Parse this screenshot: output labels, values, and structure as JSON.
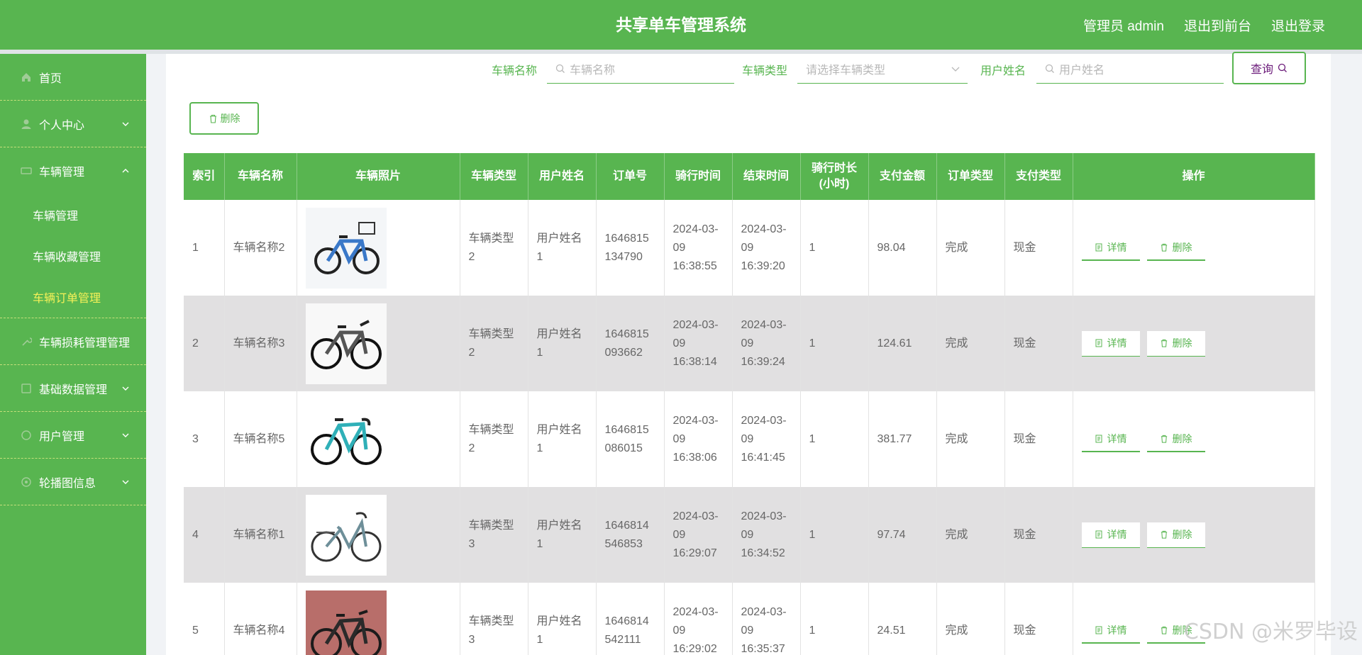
{
  "header": {
    "title": "共享单车管理系统",
    "admin_label": "管理员 admin",
    "to_front_label": "退出到前台",
    "logout_label": "退出登录"
  },
  "sidebar": {
    "items": [
      {
        "label": "首页"
      },
      {
        "label": "个人中心"
      },
      {
        "label": "车辆管理"
      },
      {
        "label": "车辆损耗管理管理"
      },
      {
        "label": "基础数据管理"
      },
      {
        "label": "用户管理"
      },
      {
        "label": "轮播图信息"
      }
    ],
    "submenu": [
      {
        "label": "车辆管理"
      },
      {
        "label": "车辆收藏管理"
      },
      {
        "label": "车辆订单管理"
      }
    ]
  },
  "search": {
    "vehicle_name_label": "车辆名称",
    "vehicle_name_placeholder": "车辆名称",
    "vehicle_type_label": "车辆类型",
    "vehicle_type_placeholder": "请选择车辆类型",
    "user_name_label": "用户姓名",
    "user_name_placeholder": "用户姓名",
    "query_label": "查询"
  },
  "toolbar": {
    "delete_label": "删除"
  },
  "table": {
    "headers": [
      "索引",
      "车辆名称",
      "车辆照片",
      "车辆类型",
      "用户姓名",
      "订单号",
      "骑行时间",
      "结束时间",
      "骑行时长(小时)",
      "支付金额",
      "订单类型",
      "支付类型",
      "操作"
    ],
    "header_duration_line1": "骑行时长",
    "header_duration_line2": "(小时)",
    "detail_label": "详情",
    "delete_label": "删除",
    "rows": [
      {
        "index": "1",
        "name": "车辆名称2",
        "type": "车辆类型2",
        "user": "用户姓名1",
        "order": "1646815134790",
        "start": "2024-03-09 16:38:55",
        "end": "2024-03-09 16:39:20",
        "duration": "1",
        "amount": "98.04",
        "order_type": "完成",
        "pay_type": "现金"
      },
      {
        "index": "2",
        "name": "车辆名称3",
        "type": "车辆类型2",
        "user": "用户姓名1",
        "order": "1646815093662",
        "start": "2024-03-09 16:38:14",
        "end": "2024-03-09 16:39:24",
        "duration": "1",
        "amount": "124.61",
        "order_type": "完成",
        "pay_type": "现金"
      },
      {
        "index": "3",
        "name": "车辆名称5",
        "type": "车辆类型2",
        "user": "用户姓名1",
        "order": "1646815086015",
        "start": "2024-03-09 16:38:06",
        "end": "2024-03-09 16:41:45",
        "duration": "1",
        "amount": "381.77",
        "order_type": "完成",
        "pay_type": "现金"
      },
      {
        "index": "4",
        "name": "车辆名称1",
        "type": "车辆类型3",
        "user": "用户姓名1",
        "order": "1646814546853",
        "start": "2024-03-09 16:29:07",
        "end": "2024-03-09 16:34:52",
        "duration": "1",
        "amount": "97.74",
        "order_type": "完成",
        "pay_type": "现金"
      },
      {
        "index": "5",
        "name": "车辆名称4",
        "type": "车辆类型3",
        "user": "用户姓名1",
        "order": "1646814542111",
        "start": "2024-03-09 16:29:02",
        "end": "2024-03-09 16:35:37",
        "duration": "1",
        "amount": "24.51",
        "order_type": "完成",
        "pay_type": "现金"
      }
    ]
  },
  "watermark": "CSDN @米罗毕设",
  "colors": {
    "primary": "#58b550",
    "active_submenu": "#f6f158",
    "row_alt": "#e1e0e1"
  }
}
